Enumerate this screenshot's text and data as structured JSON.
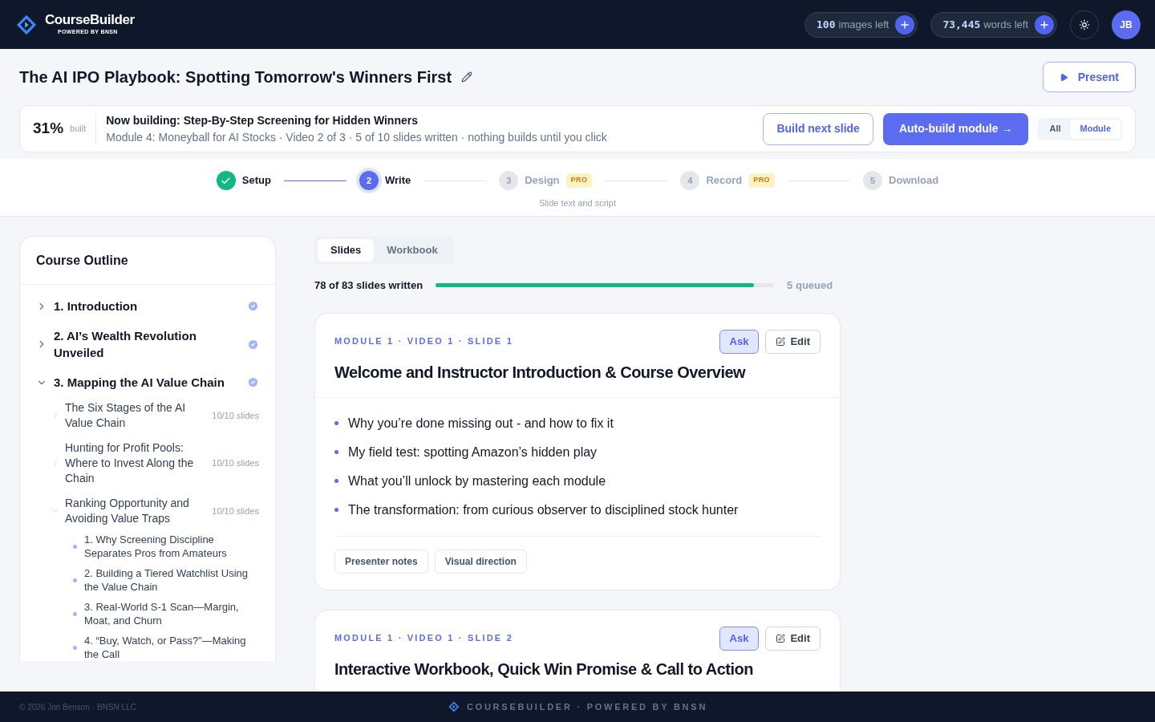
{
  "brand": {
    "name": "CourseBuilder",
    "tagline": "POWERED BY BNSN"
  },
  "credits": [
    {
      "amount": "100",
      "label": "images left"
    },
    {
      "amount": "73,445",
      "label": "words left"
    }
  ],
  "user": {
    "initials": "JB"
  },
  "course": {
    "title": "The AI IPO Playbook: Spotting Tomorrow's Winners First",
    "present": "Present"
  },
  "build": {
    "percent": "31%",
    "percent_label": "built",
    "title": "Now building: Step-By-Step Screening for Hidden Winners",
    "detail": "Module 4: Moneyball for AI Stocks · Video 2 of 3 · 5 of 10 slides written · nothing builds until you click",
    "next": "Build next slide",
    "auto": "Auto-build module →",
    "scopes": [
      {
        "label": "All",
        "selected": false
      },
      {
        "label": "Module",
        "selected": true
      }
    ]
  },
  "stepper": {
    "steps": [
      {
        "label": "Setup",
        "done": true,
        "current": false
      },
      {
        "number": "2",
        "label": "Write",
        "done": false,
        "current": true
      },
      {
        "number": "3",
        "label": "Design",
        "done": false,
        "current": false,
        "badge": "PRO"
      },
      {
        "number": "4",
        "label": "Record",
        "done": false,
        "current": false,
        "badge": "PRO"
      },
      {
        "number": "5",
        "label": "Download",
        "done": false,
        "current": false
      }
    ],
    "caption": "Slide text and script"
  },
  "outline": {
    "title": "Course Outline",
    "modules": [
      {
        "title": "1. Introduction",
        "expanded": false,
        "done": true
      },
      {
        "title": "2. AI’s Wealth Revolution Unveiled",
        "expanded": false,
        "done": true
      },
      {
        "title": "3. Mapping the AI Value Chain",
        "expanded": true,
        "done": true,
        "children": [
          {
            "title": "The Six Stages of the AI Value Chain",
            "count": "10/10 slides",
            "expanded": false
          },
          {
            "title": "Hunting for Profit Pools: Where to Invest Along the Chain",
            "count": "10/10 slides",
            "expanded": false
          },
          {
            "title": "Ranking Opportunity and Avoiding Value Traps",
            "count": "10/10 slides",
            "expanded": true,
            "children": [
              {
                "title": "1. Why Screening Discipline Separates Pros from Amateurs"
              },
              {
                "title": "2. Building a Tiered Watchlist Using the Value Chain"
              },
              {
                "title": "3. Real-World S-1 Scan—Margin, Moat, and Churn"
              },
              {
                "title": "4. “Buy, Watch, or Pass?”—Making the Call"
              }
            ]
          }
        ]
      }
    ]
  },
  "tabs": [
    {
      "label": "Slides",
      "selected": true
    },
    {
      "label": "Workbook",
      "selected": false
    }
  ],
  "progress": {
    "label": "78 of 83 slides written",
    "level": 0.94,
    "queued": "5 queued"
  },
  "slides": [
    {
      "eyebrow": "MODULE 1 · VIDEO 1 · SLIDE 1",
      "title": "Welcome and Instructor Introduction & Course Overview",
      "ask": "Ask",
      "edit": "Edit",
      "bullets": [
        "Why you’re done missing out - and how to fix it",
        "My field test: spotting Amazon’s hidden play",
        "What you’ll unlock by mastering each module",
        "The transformation: from curious observer to disciplined stock hunter"
      ],
      "extras": [
        "Presenter notes",
        "Visual direction"
      ]
    },
    {
      "eyebrow": "MODULE 1 · VIDEO 1 · SLIDE 2",
      "title": "Interactive Workbook, Quick Win Promise & Call to Action",
      "ask": "Ask",
      "edit": "Edit"
    }
  ],
  "footer": {
    "copyright": "© 2026 Jon Benson · BNSN LLC",
    "brand": "COURSEBUILDER · POWERED BY BNSN"
  }
}
